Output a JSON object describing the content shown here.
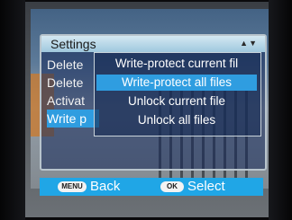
{
  "header": {
    "title": "Settings",
    "arrows": "▲▼"
  },
  "left_menu": {
    "items": [
      {
        "label": "Delete",
        "selected": false
      },
      {
        "label": "Delete",
        "selected": false
      },
      {
        "label": "Activat",
        "selected": false
      },
      {
        "label": "Write p",
        "selected": true
      }
    ]
  },
  "submenu": {
    "items": [
      {
        "label": "Write-protect current fil",
        "selected": false
      },
      {
        "label": "Write-protect all files",
        "selected": true
      },
      {
        "label": "Unlock current file",
        "selected": false
      },
      {
        "label": "Unlock all files",
        "selected": false
      }
    ]
  },
  "footer": {
    "menu_key": "MENU",
    "back_label": "Back",
    "ok_key": "OK",
    "select_label": "Select"
  },
  "colors": {
    "highlight": "#2f9de0",
    "footer_bg": "#20a6e6",
    "header_bg": "#bcd9e8"
  }
}
